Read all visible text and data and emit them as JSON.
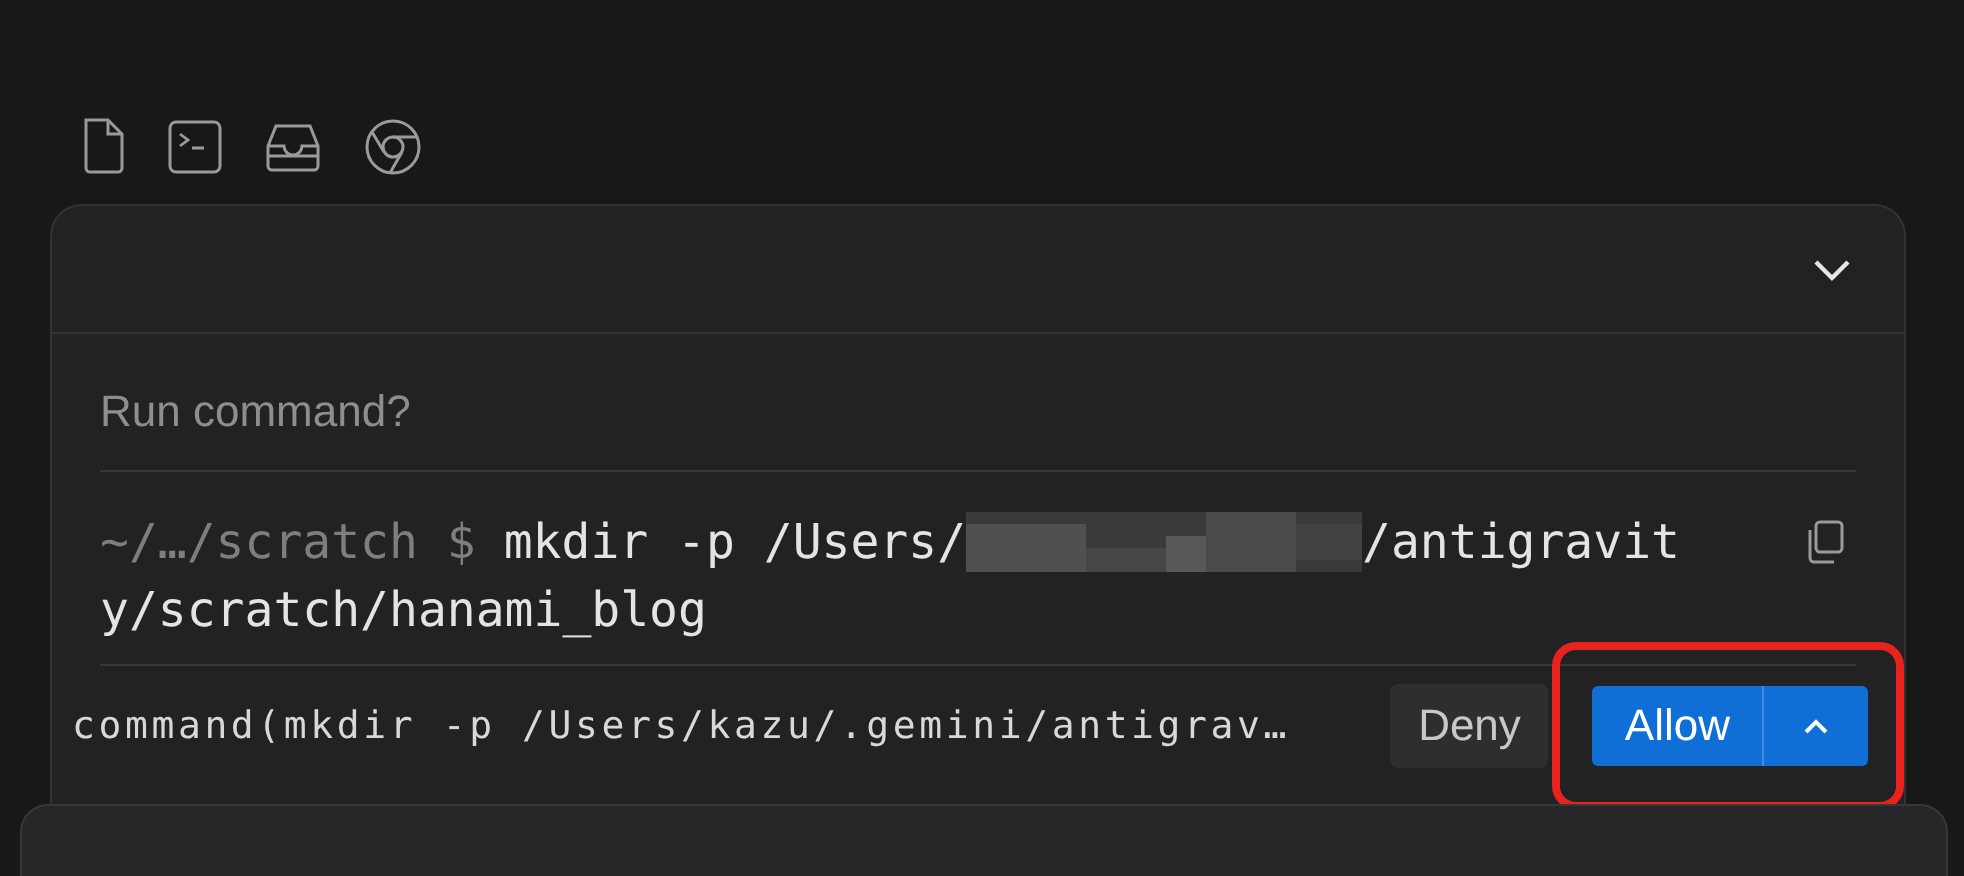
{
  "toolbar": {
    "icons": [
      {
        "kind": "file"
      },
      {
        "kind": "terminal"
      },
      {
        "kind": "inbox"
      },
      {
        "kind": "browser"
      }
    ]
  },
  "dialog": {
    "title": "Run command?",
    "command": {
      "prompt": "~/…/scratch $",
      "before_redaction": "mkdir -p /Users/",
      "redacted": true,
      "after_redaction": "/antigravit",
      "continuation": "y/scratch/hanami_blog"
    },
    "rule": "command(mkdir -p /Users/kazu/.gemini/antigrav…",
    "buttons": [
      {
        "kind": "deny",
        "label": "Deny"
      },
      {
        "kind": "allow",
        "label": "Allow",
        "highlighted": true
      }
    ]
  }
}
